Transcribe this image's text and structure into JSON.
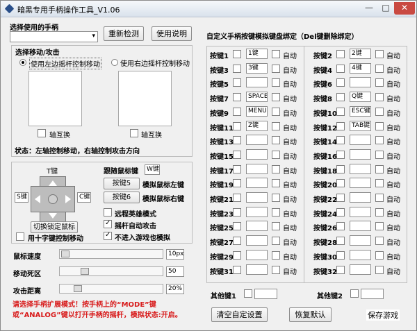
{
  "window": {
    "title": "暗黑专用手柄操作工具_V1.06",
    "min": "—",
    "max": "□",
    "close": "✕",
    "icon": "app-diamond-icon"
  },
  "controls": {
    "select_controller": "选择使用的手柄",
    "redetect": "重新检测",
    "manual": "使用说明"
  },
  "move_attack": {
    "title": "选择移动/攻击",
    "left_radio": "使用左边摇杆控制移动",
    "right_radio": "使用右边摇杆控制移动",
    "axis_swap": "轴互换",
    "status": "状态：左轴控制移动，右轴控制攻击方向"
  },
  "mouse": {
    "t_key": "T键",
    "s_key": "S键",
    "c_key": "C键",
    "lock": "切换锁定鼠标",
    "dpad_control": "用十字键控制移动",
    "follow": "跟随鼠标键",
    "follow_key": "W键",
    "key5": "按键5",
    "key6": "按键6",
    "sim_left": "模拟鼠标左键",
    "sim_right": "模拟鼠标右键",
    "remote_hero": "远程英雄模式",
    "auto_attack": "摇杆自动攻击",
    "no_game": "不进入游戏也模拟"
  },
  "sliders": [
    {
      "label": "鼠标速度",
      "value": "10px"
    },
    {
      "label": "移动死区",
      "value": "50"
    },
    {
      "label": "攻击距离",
      "value": "20%"
    }
  ],
  "warning": "请选择手柄扩展模式！按手柄上的“MODE”键或“ANALOG”键以打开手柄的摇杆，模拟状态:开启。",
  "custom": {
    "title": "自定义手柄按键模拟键盘绑定（Del键删除绑定）",
    "other1": "其他键1",
    "other2": "其他键2",
    "clear": "清空自定设置",
    "restore": "恢复默认",
    "save": "保存游戏"
  },
  "keys": [
    {
      "label": "按键1",
      "value": "1键",
      "auto": "自动"
    },
    {
      "label": "按键2",
      "value": "2键",
      "auto": "自动"
    },
    {
      "label": "按键3",
      "value": "3键",
      "auto": "自动"
    },
    {
      "label": "按键4",
      "value": "4键",
      "auto": "自动"
    },
    {
      "label": "按键5",
      "value": "",
      "auto": "自动"
    },
    {
      "label": "按键6",
      "value": "",
      "auto": "自动"
    },
    {
      "label": "按键7",
      "value": "SPACE",
      "auto": "自动"
    },
    {
      "label": "按键8",
      "value": "Q键",
      "auto": "自动"
    },
    {
      "label": "按键9",
      "value": "MENU",
      "auto": "自动"
    },
    {
      "label": "按键10",
      "value": "ESC键",
      "auto": "自动"
    },
    {
      "label": "按键11",
      "value": "Z键",
      "auto": "自动"
    },
    {
      "label": "按键12",
      "value": "TAB键",
      "auto": "自动"
    },
    {
      "label": "按键13",
      "value": "",
      "auto": "自动"
    },
    {
      "label": "按键14",
      "value": "",
      "auto": "自动"
    },
    {
      "label": "按键15",
      "value": "",
      "auto": "自动"
    },
    {
      "label": "按键16",
      "value": "",
      "auto": "自动"
    },
    {
      "label": "按键17",
      "value": "",
      "auto": "自动"
    },
    {
      "label": "按键18",
      "value": "",
      "auto": "自动"
    },
    {
      "label": "按键19",
      "value": "",
      "auto": "自动"
    },
    {
      "label": "按键20",
      "value": "",
      "auto": "自动"
    },
    {
      "label": "按键21",
      "value": "",
      "auto": "自动"
    },
    {
      "label": "按键22",
      "value": "",
      "auto": "自动"
    },
    {
      "label": "按键23",
      "value": "",
      "auto": "自动"
    },
    {
      "label": "按键24",
      "value": "",
      "auto": "自动"
    },
    {
      "label": "按键25",
      "value": "",
      "auto": "自动"
    },
    {
      "label": "按键26",
      "value": "",
      "auto": "自动"
    },
    {
      "label": "按键27",
      "value": "",
      "auto": "自动"
    },
    {
      "label": "按键28",
      "value": "",
      "auto": "自动"
    },
    {
      "label": "按键29",
      "value": "",
      "auto": "自动"
    },
    {
      "label": "按键30",
      "value": "",
      "auto": "自动"
    },
    {
      "label": "按键31",
      "value": "",
      "auto": "自动"
    },
    {
      "label": "按键32",
      "value": "",
      "auto": "自动"
    }
  ]
}
